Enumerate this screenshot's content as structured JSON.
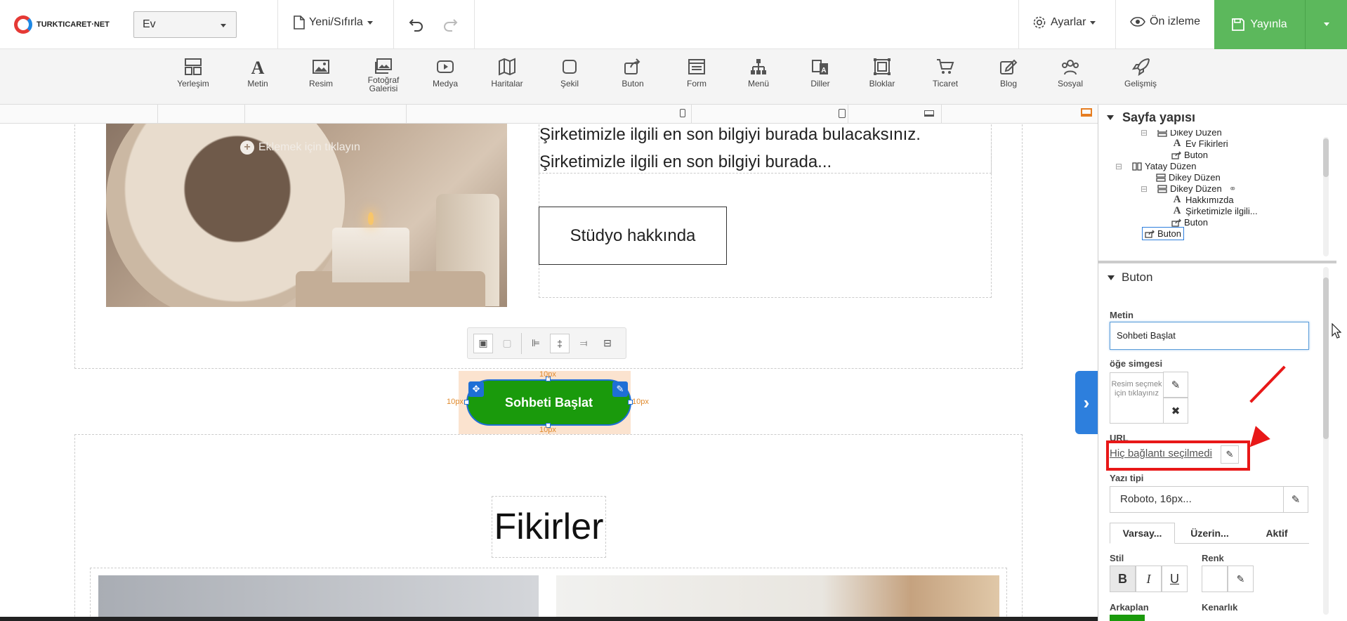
{
  "header": {
    "logo_text": "TURKTICARET·NET",
    "page_select": "Ev",
    "new_reset": "Yeni/Sıfırla",
    "settings": "Ayarlar",
    "preview": "Ön izleme",
    "publish": "Yayınla"
  },
  "toolbar": {
    "tools": [
      {
        "label": "Yerleşim",
        "icon": "layout-icon"
      },
      {
        "label": "Metin",
        "icon": "text-icon"
      },
      {
        "label": "Resim",
        "icon": "image-icon"
      },
      {
        "label": "Fotoğraf Galerisi",
        "icon": "gallery-icon"
      },
      {
        "label": "Medya",
        "icon": "media-icon"
      },
      {
        "label": "Haritalar",
        "icon": "map-icon"
      },
      {
        "label": "Şekil",
        "icon": "shape-icon"
      },
      {
        "label": "Buton",
        "icon": "button-icon"
      },
      {
        "label": "Form",
        "icon": "form-icon"
      },
      {
        "label": "Menü",
        "icon": "menu-icon"
      },
      {
        "label": "Diller",
        "icon": "language-icon"
      },
      {
        "label": "Bloklar",
        "icon": "blocks-icon"
      },
      {
        "label": "Ticaret",
        "icon": "cart-icon"
      },
      {
        "label": "Blog",
        "icon": "blog-icon"
      },
      {
        "label": "Sosyal",
        "icon": "social-icon"
      },
      {
        "label": "Gelişmiş",
        "icon": "rocket-icon"
      }
    ]
  },
  "canvas": {
    "add_hint": "Eklemek için tıklayın",
    "about_line1": "Şirketimizle ilgili en son bilgiyi burada bulacaksınız.",
    "about_line2": "Şirketimizle ilgili en son bilgiyi burada...",
    "studio_button": "Stüdyo hakkında",
    "chat_button": "Sohbeti Başlat",
    "padding_label": "10px",
    "ideas_heading": "Fikirler"
  },
  "structure_panel": {
    "title": "Sayfa yapısı",
    "items": [
      {
        "label": "Dikey Düzen",
        "icon": "vertical-layout-icon"
      },
      {
        "label": "Ev Fikirleri",
        "icon": "text-icon"
      },
      {
        "label": "Buton",
        "icon": "button-icon"
      },
      {
        "label": "Yatay Düzen",
        "icon": "horizontal-layout-icon"
      },
      {
        "label": "Dikey Düzen",
        "icon": "vertical-layout-icon"
      },
      {
        "label": "Dikey Düzen",
        "icon": "vertical-layout-icon"
      },
      {
        "label": "Hakkımızda",
        "icon": "text-icon"
      },
      {
        "label": "Şirketimizle ilgili...",
        "icon": "text-icon"
      },
      {
        "label": "Buton",
        "icon": "button-icon"
      },
      {
        "label": "Buton",
        "icon": "button-icon"
      }
    ]
  },
  "props_panel": {
    "title": "Buton",
    "text_label": "Metin",
    "text_value": "Sohbeti Başlat",
    "icon_label": "öğe simgesi",
    "icon_placeholder": "Resim seçmek için tıklayınız",
    "url_label": "URL",
    "url_value": "Hiç bağlantı seçilmedi",
    "font_label": "Yazı tipi",
    "font_value": "Roboto, 16px...",
    "tabs": [
      "Varsay...",
      "Üzerin...",
      "Aktif"
    ],
    "style_label": "Stil",
    "color_label": "Renk",
    "background_label": "Arkaplan",
    "border_label": "Kenarlık",
    "bold": "B",
    "italic": "I",
    "underline": "U"
  },
  "colors": {
    "publish": "#5cb85c",
    "chat_button": "#1a9a0c",
    "selection": "#1e6fd6",
    "highlight": "#e81818"
  }
}
